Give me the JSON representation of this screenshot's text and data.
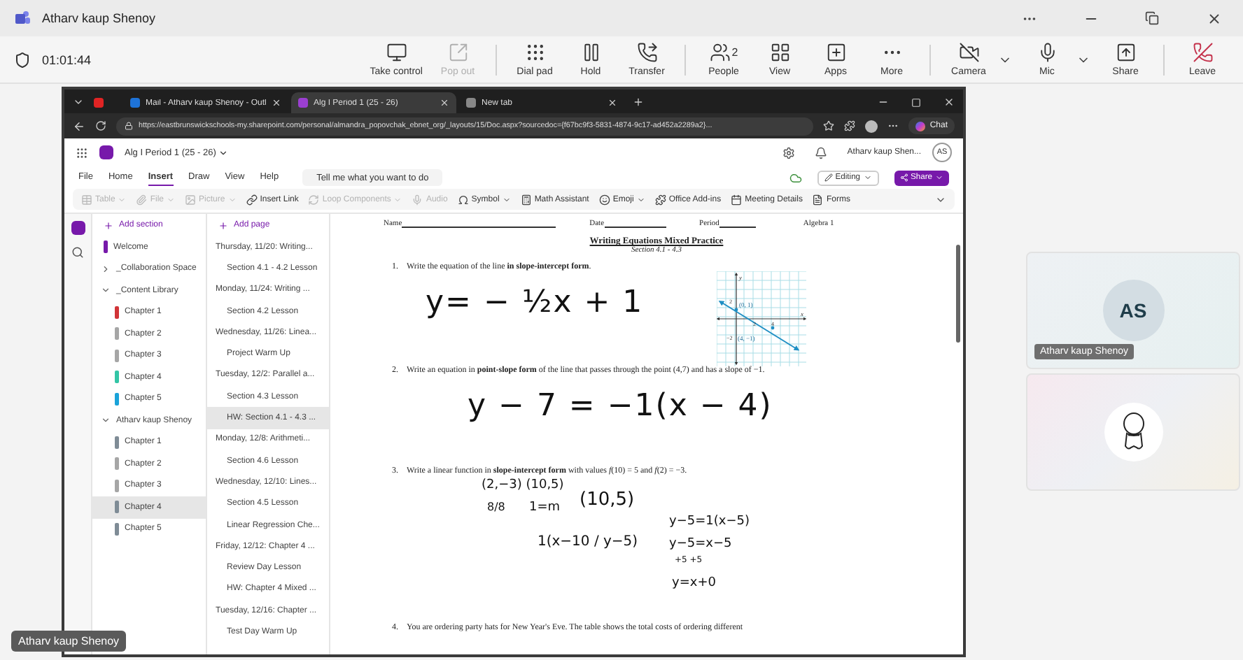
{
  "window": {
    "title": "Atharv kaup Shenoy"
  },
  "call": {
    "timer": "01:01:44",
    "groups": [
      [
        {
          "label": "Take control",
          "disabled": false,
          "dropdown": false,
          "kind": "normal"
        },
        {
          "label": "Pop out",
          "disabled": true,
          "dropdown": false,
          "kind": "normal"
        }
      ],
      [
        {
          "label": "Dial pad",
          "disabled": false,
          "dropdown": false,
          "kind": "normal"
        },
        {
          "label": "Hold",
          "disabled": false,
          "dropdown": false,
          "kind": "normal"
        },
        {
          "label": "Transfer",
          "disabled": false,
          "dropdown": false,
          "kind": "normal"
        }
      ],
      [
        {
          "label": "People",
          "badge": "2",
          "disabled": false,
          "dropdown": false,
          "kind": "normal"
        },
        {
          "label": "View",
          "disabled": false,
          "dropdown": false,
          "kind": "normal"
        },
        {
          "label": "Apps",
          "disabled": false,
          "dropdown": false,
          "kind": "normal"
        },
        {
          "label": "More",
          "disabled": false,
          "dropdown": false,
          "kind": "normal"
        }
      ],
      [
        {
          "label": "Camera",
          "disabled": false,
          "dropdown": true,
          "kind": "normal"
        },
        {
          "label": "Mic",
          "disabled": false,
          "dropdown": true,
          "kind": "normal"
        },
        {
          "label": "Share",
          "disabled": false,
          "dropdown": false,
          "kind": "normal"
        }
      ],
      [
        {
          "label": "Leave",
          "disabled": false,
          "dropdown": false,
          "kind": "danger"
        }
      ]
    ]
  },
  "browser": {
    "tabs": [
      {
        "kind": "pinned",
        "selected": false
      },
      {
        "kind": "page",
        "label": "Mail - Atharv kaup Shenoy - Outl",
        "selected": false
      },
      {
        "kind": "page",
        "label": "Alg I Period 1 (25 - 26)",
        "selected": true
      },
      {
        "kind": "page",
        "label": "New tab",
        "selected": false
      }
    ],
    "url": "https://eastbrunswickschools-my.sharepoint.com/personal/almandra_popovchak_ebnet_org/_layouts/15/Doc.aspx?sourcedoc={f67bc9f3-5831-4874-9c17-ad452a2289a2}...",
    "chat_button": "Chat"
  },
  "onenote": {
    "notebook": "Alg I Period 1 (25 - 26)",
    "user": "Atharv kaup Shen...",
    "avatar": "AS",
    "ribbon_tabs": [
      {
        "label": "File",
        "selected": false
      },
      {
        "label": "Home",
        "selected": false
      },
      {
        "label": "Insert",
        "selected": true
      },
      {
        "label": "Draw",
        "selected": false
      },
      {
        "label": "View",
        "selected": false
      },
      {
        "label": "Help",
        "selected": false
      }
    ],
    "search": {
      "placeholder": "Tell me what you want to do"
    },
    "editing": "Editing",
    "share": "Share",
    "commands": [
      {
        "label": "Table",
        "disabled": true,
        "dropdown": true
      },
      {
        "label": "File",
        "disabled": true,
        "dropdown": true
      },
      {
        "label": "Picture",
        "disabled": true,
        "dropdown": true
      },
      {
        "label": "Insert Link",
        "disabled": false,
        "dropdown": false
      },
      {
        "label": "Loop Components",
        "disabled": true,
        "dropdown": true
      },
      {
        "label": "Audio",
        "disabled": true,
        "dropdown": false
      },
      {
        "label": "Symbol",
        "disabled": false,
        "dropdown": true
      },
      {
        "label": "Math Assistant",
        "disabled": false,
        "dropdown": false
      },
      {
        "label": "Emoji",
        "disabled": false,
        "dropdown": true
      },
      {
        "label": "Office Add-ins",
        "disabled": false,
        "dropdown": false
      },
      {
        "label": "Meeting Details",
        "disabled": false,
        "dropdown": false
      },
      {
        "label": "Forms",
        "disabled": false,
        "dropdown": false
      }
    ]
  },
  "sections": {
    "add": "Add section",
    "items": [
      {
        "kind": "section",
        "label": "Welcome",
        "color": "#7719aa",
        "selected": false
      },
      {
        "kind": "group",
        "label": "_Collaboration Space",
        "expanded": false
      },
      {
        "kind": "group",
        "label": "_Content Library",
        "expanded": true,
        "children": [
          {
            "kind": "section",
            "label": "Chapter 1",
            "color": "#d13438",
            "selected": false
          },
          {
            "kind": "section",
            "label": "Chapter 2",
            "color": "#a6a6a6",
            "selected": false
          },
          {
            "kind": "section",
            "label": "Chapter 3",
            "color": "#a6a6a6",
            "selected": false
          },
          {
            "kind": "section",
            "label": "Chapter 4",
            "color": "#33c5a6",
            "selected": false
          },
          {
            "kind": "section",
            "label": "Chapter 5",
            "color": "#1aa3d9",
            "selected": false
          }
        ]
      },
      {
        "kind": "group",
        "label": "Atharv kaup Shenoy",
        "expanded": true,
        "children": [
          {
            "kind": "section",
            "label": "Chapter 1",
            "color": "#7f8c96",
            "selected": false
          },
          {
            "kind": "section",
            "label": "Chapter 2",
            "color": "#a6a6a6",
            "selected": false
          },
          {
            "kind": "section",
            "label": "Chapter 3",
            "color": "#a6a6a6",
            "selected": false
          },
          {
            "kind": "section",
            "label": "Chapter 4",
            "color": "#7f8c96",
            "selected": true
          },
          {
            "kind": "section",
            "label": "Chapter 5",
            "color": "#7f8c96",
            "selected": false
          }
        ]
      }
    ]
  },
  "pages": {
    "add": "Add page",
    "items": [
      {
        "label": "Thursday, 11/20: Writing...",
        "selected": false,
        "children": [
          {
            "label": "Section 4.1 - 4.2 Lesson",
            "selected": false
          }
        ]
      },
      {
        "label": "Monday, 11/24: Writing ...",
        "selected": false,
        "children": [
          {
            "label": "Section 4.2 Lesson",
            "selected": false
          }
        ]
      },
      {
        "label": "Wednesday, 11/26: Linea...",
        "selected": false,
        "children": [
          {
            "label": "Project Warm Up",
            "selected": false
          }
        ]
      },
      {
        "label": "Tuesday, 12/2: Parallel a...",
        "selected": false,
        "children": [
          {
            "label": "Section 4.3 Lesson",
            "selected": false
          },
          {
            "label": "HW: Section 4.1 - 4.3 ...",
            "selected": true
          }
        ]
      },
      {
        "label": "Monday, 12/8: Arithmeti...",
        "selected": false,
        "children": [
          {
            "label": "Section 4.6 Lesson",
            "selected": false
          }
        ]
      },
      {
        "label": "Wednesday, 12/10: Lines...",
        "selected": false,
        "children": [
          {
            "label": "Section 4.5 Lesson",
            "selected": false
          },
          {
            "label": "Linear Regression Che...",
            "selected": false
          }
        ]
      },
      {
        "label": "Friday, 12/12: Chapter 4 ...",
        "selected": false,
        "children": [
          {
            "label": "Review Day Lesson",
            "selected": false
          },
          {
            "label": "HW: Chapter 4 Mixed ...",
            "selected": false
          }
        ]
      },
      {
        "label": "Tuesday, 12/16: Chapter ...",
        "selected": false,
        "children": [
          {
            "label": "Test Day Warm Up",
            "selected": false
          }
        ]
      }
    ]
  },
  "worksheet": {
    "fields": [
      "Name",
      "Date",
      "Period"
    ],
    "course": "Algebra 1",
    "title": "Writing Equations Mixed Practice",
    "subtitle": "Section 4.1 - 4.3",
    "questions": [
      {
        "number": "1.",
        "text": "Write the equation of the line **in slope-intercept form**.",
        "ink": [
          "y= − ½x + 1"
        ],
        "graph": {
          "axis_labels": [
            "y",
            "x"
          ],
          "tick_labels": [
            "2",
            "2",
            "4",
            "−2"
          ],
          "point_labels": [
            "(0, 1)",
            "(4, −1)"
          ]
        }
      },
      {
        "number": "2.",
        "text": "Write an equation in **point-slope form** of the line that passes through the point (4,7) and has a slope of −1.",
        "ink": [
          "y − 7 = −1(x − 4)"
        ]
      },
      {
        "number": "3.",
        "text": "Write a linear function in **slope-intercept form** with values *f*(10) = 5 and *f*(2) = −3.",
        "ink": [
          "(2,−3) (10,5)",
          "8/8",
          "1=m",
          "(10,5)",
          "1(x−10 / y−5)",
          "y−5=1(x−5)",
          "y−5=x−5",
          "+5   +5",
          "y=x+0"
        ]
      },
      {
        "number": "4.",
        "text": "You are ordering party hats for New Year's Eve. The table shows the total costs of ordering different"
      }
    ]
  },
  "tiles": [
    {
      "kind": "initials",
      "initials": "AS",
      "name": "Atharv kaup Shenoy"
    },
    {
      "kind": "picture"
    }
  ],
  "presenter_label": "Atharv kaup Shenoy"
}
